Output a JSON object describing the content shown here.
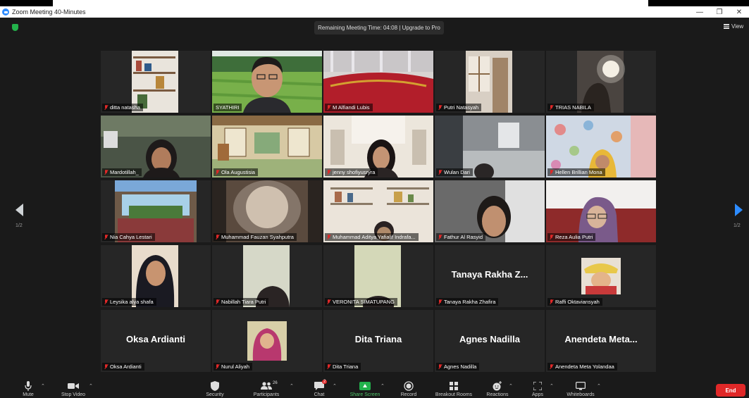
{
  "window": {
    "title": "Zoom Meeting 40-Minutes"
  },
  "meeting": {
    "remaining_text": "Remaining Meeting Time: 04:08 | Upgrade to Pro",
    "view_label": "View",
    "page_left": "1/2",
    "page_right": "1/2"
  },
  "participants": [
    {
      "name": "ditta natasha"
    },
    {
      "name": "SYATHIRI"
    },
    {
      "name": "M Alfiandi Lubis"
    },
    {
      "name": "Putri Natasyah"
    },
    {
      "name": "TRIAS NABILA"
    },
    {
      "name": "Mardotillah_"
    },
    {
      "name": "Ola Augustisia"
    },
    {
      "name": "jenny shofiyusryra"
    },
    {
      "name": "Wulan Dari"
    },
    {
      "name": "Hellen Brillian Mona"
    },
    {
      "name": "Nia Cahya Lestari"
    },
    {
      "name": "Muhammad Fauzan Syahputra"
    },
    {
      "name": "Muhammad Aditya Yafialif Indrafa..."
    },
    {
      "name": "Fathur Al Rasyid"
    },
    {
      "name": "Reza Aulia Putri"
    },
    {
      "name": "Leysika alya shafa"
    },
    {
      "name": "Nabillah Tiara Putri"
    },
    {
      "name": "VERONITA SIMATUPANG"
    },
    {
      "name": "Tanaya Rakha Zhafira",
      "display": "Tanaya Rakha Z..."
    },
    {
      "name": "Raffi Oktaviansyah"
    },
    {
      "name": "Oksa Ardianti",
      "display": "Oksa Ardianti"
    },
    {
      "name": "Nurul Aliyah"
    },
    {
      "name": "Dita Triana",
      "display": "Dita Triana"
    },
    {
      "name": "Agnes Nadilla",
      "display": "Agnes Nadilla"
    },
    {
      "name": "Anendeta Meta Yolandaa",
      "display": "Anendeta Meta..."
    }
  ],
  "toolbar": {
    "mute": "Mute",
    "stop_video": "Stop Video",
    "security": "Security",
    "participants": "Participants",
    "participants_count": "26",
    "chat": "Chat",
    "chat_badge": "2",
    "share_screen": "Share Screen",
    "record": "Record",
    "breakout_rooms": "Breakout Rooms",
    "reactions": "Reactions",
    "apps": "Apps",
    "whiteboards": "Whiteboards",
    "end": "End"
  },
  "colors": {
    "active_speaker": "#c9e23a",
    "share_green": "#22b14c",
    "end_red": "#e02828",
    "zoom_blue": "#2d8cff"
  }
}
